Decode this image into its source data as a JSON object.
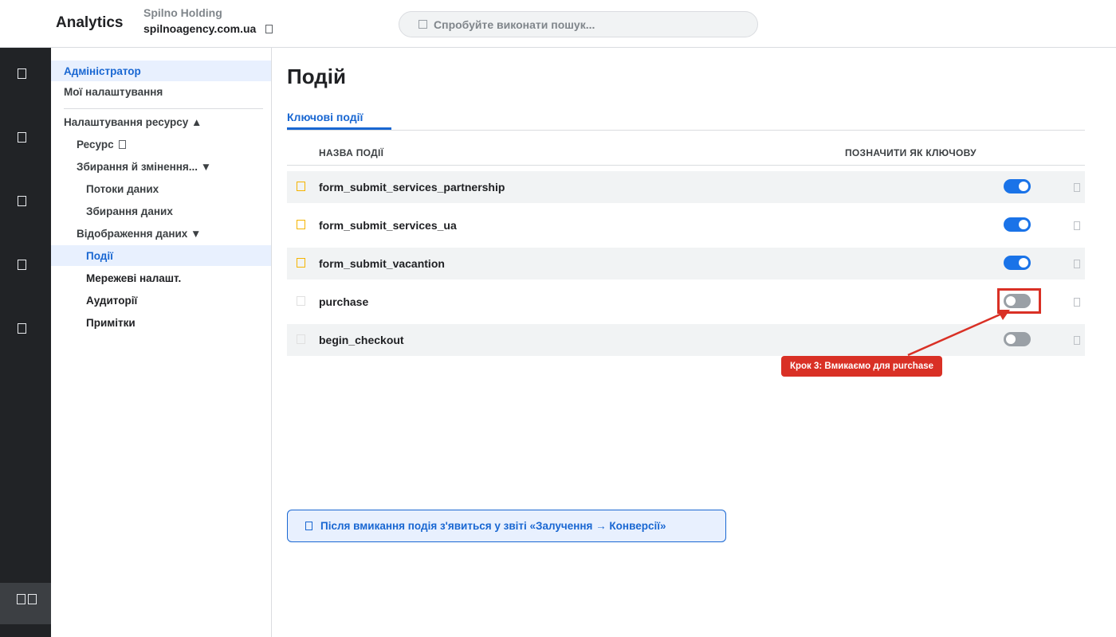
{
  "header": {
    "app_name": "Analytics",
    "account_name": "Spilno Holding",
    "property_name": "spilnoagency.com.ua",
    "search_placeholder": "Спробуйте виконати пошук..."
  },
  "nav": {
    "items": [
      {
        "label": "Адміністратор",
        "active": true
      },
      {
        "label": "Мої налаштування"
      },
      {
        "label": "Налаштування ресурсу ▲"
      },
      {
        "label": "Ресурс"
      },
      {
        "label": "Збирання й змінення... ▼"
      },
      {
        "label": "Потоки даних"
      },
      {
        "label": "Збирання даних"
      },
      {
        "label": "Відображення даних ▼"
      },
      {
        "label": "Події",
        "active": true
      },
      {
        "label": "Мережеві налашт."
      },
      {
        "label": "Аудиторії"
      },
      {
        "label": "Примітки"
      }
    ]
  },
  "main": {
    "title": "Подій",
    "tab_label": "Ключові події",
    "col_event_name": "НАЗВА ПОДІЇ",
    "col_mark_key": "ПОЗНАЧИТИ ЯК КЛЮЧОВУ",
    "events": [
      {
        "name": "form_submit_services_partnership",
        "key": true
      },
      {
        "name": "form_submit_services_ua",
        "key": true
      },
      {
        "name": "form_submit_vacantion",
        "key": true
      },
      {
        "name": "purchase",
        "key": false
      },
      {
        "name": "begin_checkout",
        "key": false
      }
    ],
    "callout": "Крок 3: Вмикаємо для purchase",
    "info_banner": "Після вмикання подія з'явиться у звіті «Залучення → Конверсії»"
  },
  "colors": {
    "accent": "#1a73e8",
    "toggle_off": "#9aa0a6",
    "annotation": "#d93025",
    "key_marker": "#f5b400",
    "rail": "#212326"
  }
}
